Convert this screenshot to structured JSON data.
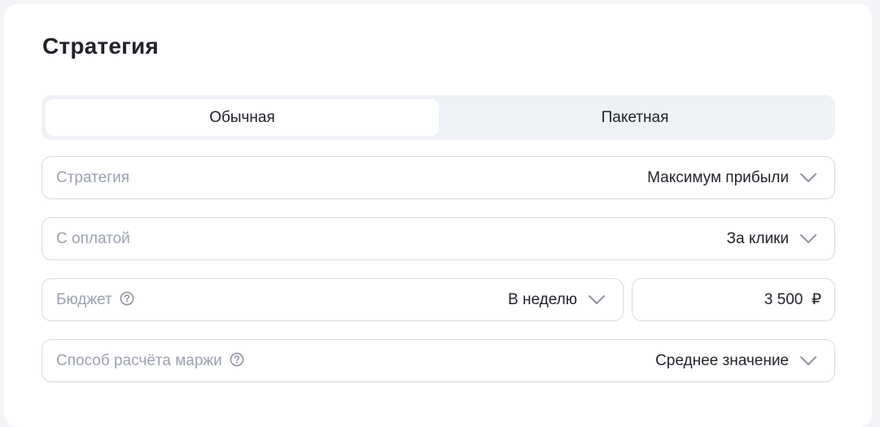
{
  "title": "Стратегия",
  "tabs": [
    {
      "label": "Обычная",
      "active": true
    },
    {
      "label": "Пакетная",
      "active": false
    }
  ],
  "fields": {
    "strategy": {
      "label": "Стратегия",
      "value": "Максимум прибыли"
    },
    "payment": {
      "label": "С оплатой",
      "value": "За клики"
    },
    "budget": {
      "label": "Бюджет",
      "period": "В неделю",
      "amount": "3 500  ₽"
    },
    "margin": {
      "label": "Способ расчёта маржи",
      "value": "Среднее значение"
    }
  },
  "icons": {
    "dropdown": "chevron-down-icon",
    "help": "question-circle-icon"
  }
}
